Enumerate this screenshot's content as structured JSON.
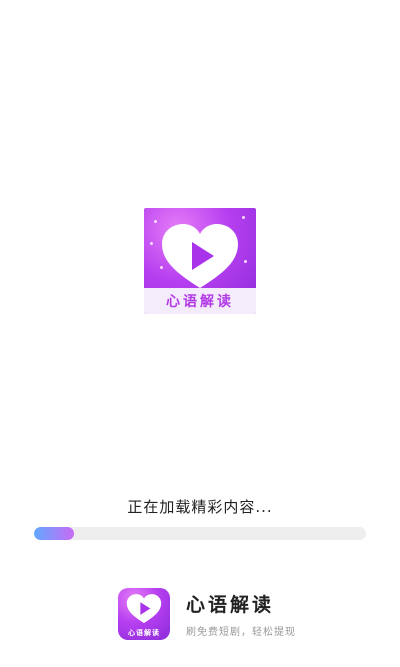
{
  "app": {
    "name": "心语解读",
    "slogan": "刷免费短剧，轻松提现"
  },
  "hero_logo": {
    "caption": "心语解读",
    "icon": "heart-play-icon"
  },
  "footer_logo": {
    "caption": "心语解读",
    "icon": "heart-play-icon"
  },
  "loading": {
    "text": "正在加载精彩内容...",
    "progress": 0.12
  },
  "colors": {
    "brand_purple": "#b63ff0",
    "progress_start": "#62a8ff",
    "progress_end": "#c86bf4",
    "track": "#eeeeee"
  }
}
